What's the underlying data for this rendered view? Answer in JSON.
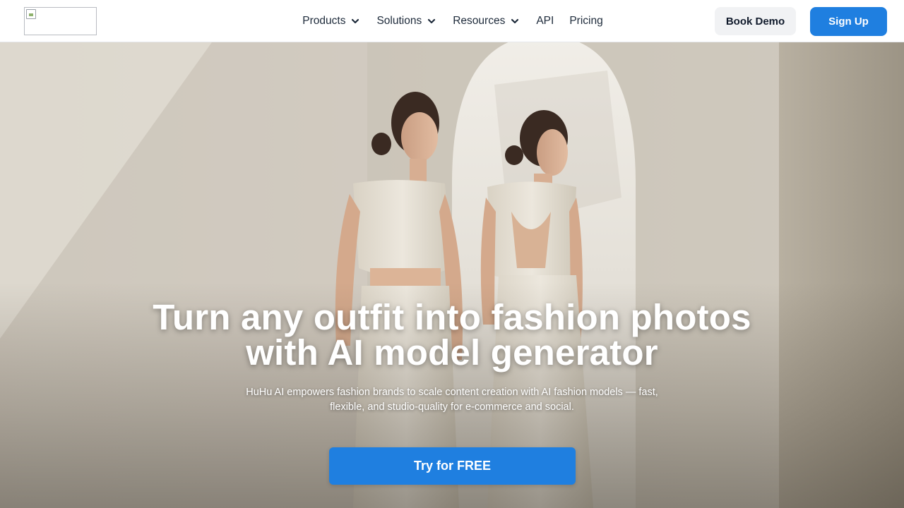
{
  "header": {
    "logo_icon": "broken-image-icon",
    "nav": [
      {
        "label": "Products",
        "has_dropdown": true
      },
      {
        "label": "Solutions",
        "has_dropdown": true
      },
      {
        "label": "Resources",
        "has_dropdown": true
      },
      {
        "label": "API",
        "has_dropdown": false
      },
      {
        "label": "Pricing",
        "has_dropdown": false
      }
    ],
    "book_demo_label": "Book Demo",
    "sign_up_label": "Sign Up"
  },
  "hero": {
    "headline_line1": "Turn any outfit into fashion photos",
    "headline_line2": "with AI model generator",
    "subtext_line1": "HuHu AI empowers fashion brands to scale content creation with AI fashion models  — fast,",
    "subtext_line2": "flexible, and studio-quality for e-commerce and social.",
    "cta_label": "Try for FREE"
  },
  "colors": {
    "accent": "#1f7fe0",
    "nav_text": "#1d2a3a",
    "demo_bg": "#f1f2f4"
  }
}
